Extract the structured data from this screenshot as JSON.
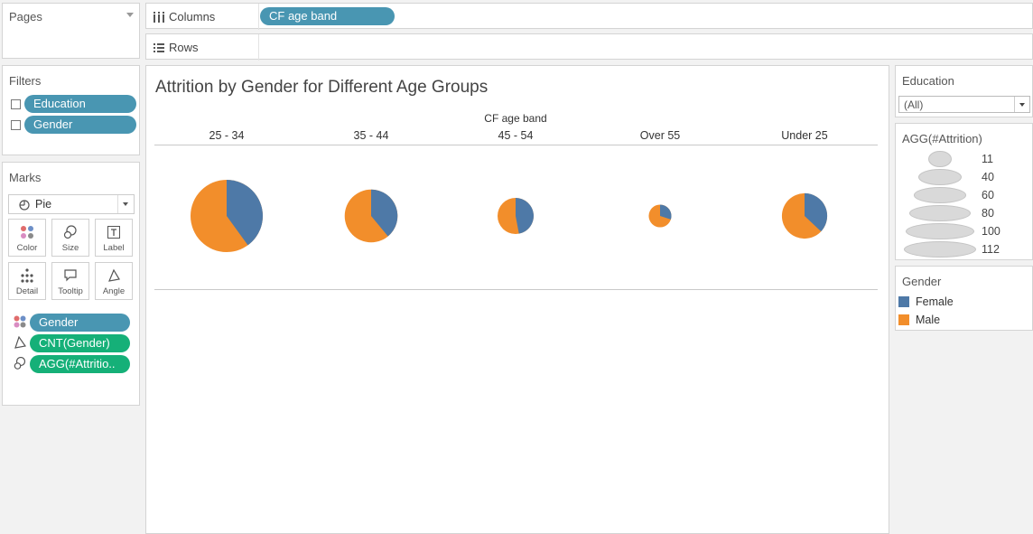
{
  "pages": {
    "title": "Pages"
  },
  "shelves": {
    "columns_label": "Columns",
    "columns_pill": "CF age band",
    "rows_label": "Rows"
  },
  "filters": {
    "title": "Filters",
    "items": [
      "Education",
      "Gender"
    ]
  },
  "marks": {
    "title": "Marks",
    "type": "Pie",
    "buttons": [
      "Color",
      "Size",
      "Label",
      "Detail",
      "Tooltip",
      "Angle"
    ],
    "pills": [
      "Gender",
      "CNT(Gender)",
      "AGG(#Attritio.."
    ]
  },
  "view": {
    "title": "Attrition by Gender for Different Age Groups",
    "header_field": "CF age band"
  },
  "education_filter": {
    "title": "Education",
    "value": "(All)"
  },
  "size_legend": {
    "title": "AGG(#Attrition)",
    "values": [
      "11",
      "40",
      "60",
      "80",
      "100",
      "112"
    ]
  },
  "color_legend": {
    "title": "Gender",
    "items": [
      "Female",
      "Male"
    ],
    "colors": [
      "#4e79a7",
      "#f28e2b"
    ]
  },
  "chart_data": {
    "type": "pie",
    "title": "Attrition by Gender for Different Age Groups",
    "column_field": "CF age band",
    "categories": [
      "25 - 34",
      "35 - 44",
      "45 - 54",
      "Over 55",
      "Under 25"
    ],
    "size_measure": "AGG(#Attrition)",
    "sizes": [
      112,
      60,
      28,
      11,
      44
    ],
    "female_share": [
      0.4,
      0.39,
      0.47,
      0.3,
      0.37
    ],
    "series": [
      {
        "name": "Female",
        "color": "#4e79a7"
      },
      {
        "name": "Male",
        "color": "#f28e2b"
      }
    ],
    "size_legend_values": [
      11,
      40,
      60,
      80,
      100,
      112
    ]
  }
}
